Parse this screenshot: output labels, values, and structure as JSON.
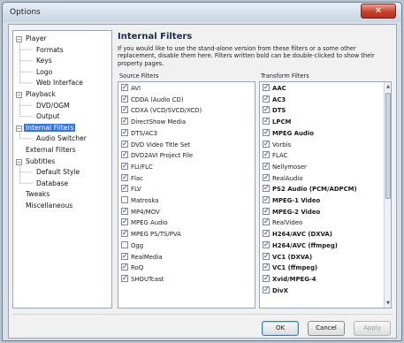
{
  "window": {
    "title": "Options",
    "close_glyph": "✕"
  },
  "tree": {
    "items": [
      {
        "label": "Player",
        "level": 0,
        "expander": "−"
      },
      {
        "label": "Formats",
        "level": 1
      },
      {
        "label": "Keys",
        "level": 1
      },
      {
        "label": "Logo",
        "level": 1
      },
      {
        "label": "Web Interface",
        "level": 1
      },
      {
        "label": "Playback",
        "level": 0,
        "expander": "−"
      },
      {
        "label": "DVD/OGM",
        "level": 1
      },
      {
        "label": "Output",
        "level": 1
      },
      {
        "label": "Internal Filters",
        "level": 0,
        "expander": "−",
        "selected": true
      },
      {
        "label": "Audio Switcher",
        "level": 1
      },
      {
        "label": "External Filters",
        "level": 0
      },
      {
        "label": "Subtitles",
        "level": 0,
        "expander": "−"
      },
      {
        "label": "Default Style",
        "level": 1
      },
      {
        "label": "Database",
        "level": 1
      },
      {
        "label": "Tweaks",
        "level": 0
      },
      {
        "label": "Miscellaneous",
        "level": 0
      }
    ]
  },
  "panel": {
    "title": "Internal Filters",
    "description": "If you would like to use the stand-alone version from these filters or a some other replacement, disable them here. Filters written bold can be double-clicked to show their property pages.",
    "source_label": "Source Filters",
    "transform_label": "Transform Filters"
  },
  "source_filters": [
    {
      "label": "AVI",
      "checked": true
    },
    {
      "label": "CDDA (Audio CD)",
      "checked": true
    },
    {
      "label": "CDXA (VCD/SVCD/XCD)",
      "checked": true
    },
    {
      "label": "DirectShow Media",
      "checked": true
    },
    {
      "label": "DTS/AC3",
      "checked": true
    },
    {
      "label": "DVD Video Title Set",
      "checked": true
    },
    {
      "label": "DVD2AVI Project File",
      "checked": true
    },
    {
      "label": "FLI/FLC",
      "checked": true
    },
    {
      "label": "Flac",
      "checked": true
    },
    {
      "label": "FLV",
      "checked": true
    },
    {
      "label": "Matroska",
      "checked": false
    },
    {
      "label": "MP4/MOV",
      "checked": true
    },
    {
      "label": "MPEG Audio",
      "checked": true
    },
    {
      "label": "MPEG PS/TS/PVA",
      "checked": true
    },
    {
      "label": "Ogg",
      "checked": false
    },
    {
      "label": "RealMedia",
      "checked": true
    },
    {
      "label": "RoQ",
      "checked": true
    },
    {
      "label": "SHOUTcast",
      "checked": true
    }
  ],
  "transform_filters": [
    {
      "label": "AAC",
      "checked": true,
      "bold": true
    },
    {
      "label": "AC3",
      "checked": true,
      "bold": true
    },
    {
      "label": "DTS",
      "checked": true,
      "bold": true
    },
    {
      "label": "LPCM",
      "checked": true,
      "bold": true
    },
    {
      "label": "MPEG Audio",
      "checked": true,
      "bold": true
    },
    {
      "label": "Vorbis",
      "checked": true,
      "bold": false
    },
    {
      "label": "FLAC",
      "checked": true,
      "bold": false
    },
    {
      "label": "Nellymoser",
      "checked": true,
      "bold": false
    },
    {
      "label": "RealAudio",
      "checked": true,
      "bold": false
    },
    {
      "label": "PS2 Audio (PCM/ADPCM)",
      "checked": true,
      "bold": true
    },
    {
      "label": "MPEG-1 Video",
      "checked": true,
      "bold": true
    },
    {
      "label": "MPEG-2 Video",
      "checked": true,
      "bold": true
    },
    {
      "label": "RealVideo",
      "checked": true,
      "bold": false
    },
    {
      "label": "H264/AVC (DXVA)",
      "checked": true,
      "bold": true
    },
    {
      "label": "H264/AVC (ffmpeg)",
      "checked": true,
      "bold": true
    },
    {
      "label": "VC1 (DXVA)",
      "checked": true,
      "bold": true
    },
    {
      "label": "VC1 (ffmpeg)",
      "checked": true,
      "bold": true
    },
    {
      "label": "Xvid/MPEG-4",
      "checked": true,
      "bold": true
    },
    {
      "label": "DivX",
      "checked": true,
      "bold": true
    }
  ],
  "buttons": {
    "ok": "OK",
    "cancel": "Cancel",
    "apply": "Apply"
  },
  "colors": {
    "selection": "#3875d7",
    "close_button": "#c8402d"
  }
}
